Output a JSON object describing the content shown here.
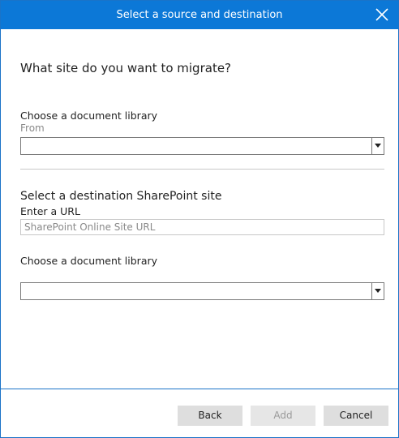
{
  "dialog": {
    "title": "Select a source and destination"
  },
  "question": "What site do you want to migrate?",
  "source": {
    "library_label": "Choose a document library",
    "from_label": "From",
    "library_value": ""
  },
  "destination": {
    "section_title": "Select a destination SharePoint site",
    "url_label": "Enter a URL",
    "url_placeholder": "SharePoint Online Site URL",
    "url_value": "",
    "library_label": "Choose a document library",
    "library_value": ""
  },
  "buttons": {
    "back": "Back",
    "add": "Add",
    "cancel": "Cancel"
  },
  "colors": {
    "titlebar": "#0c78d7",
    "border": "#1a73c8",
    "button_bg": "#dedede"
  },
  "icons": {
    "close": "close-icon",
    "dropdown": "chevron-down-icon"
  }
}
